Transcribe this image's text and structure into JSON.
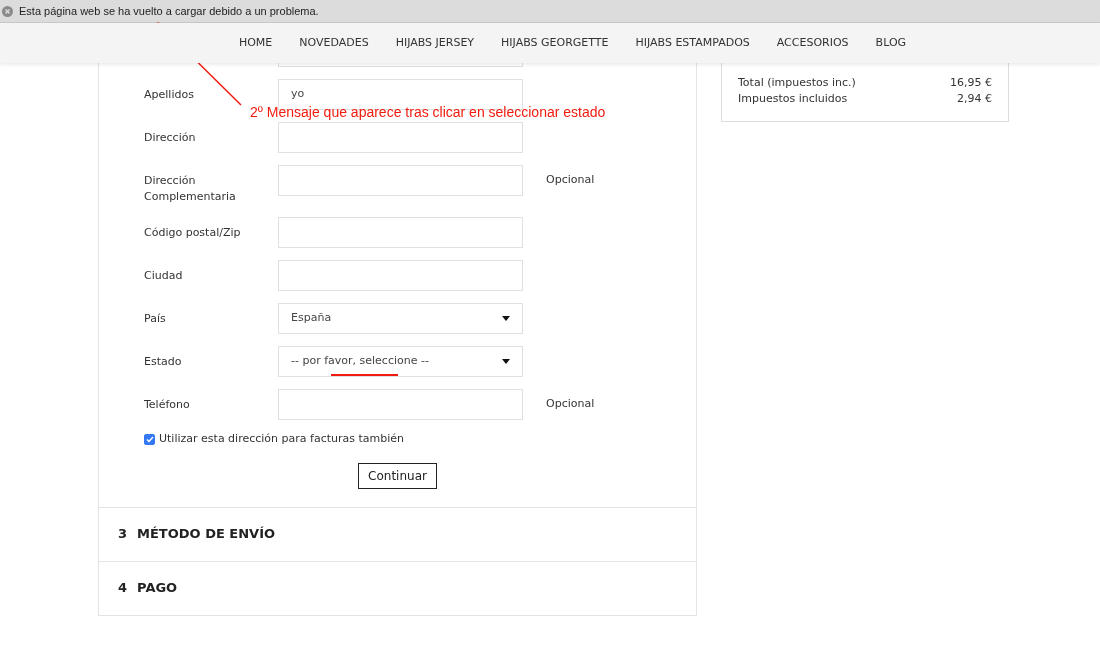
{
  "notice": {
    "text": "Esta página web se ha vuelto a cargar debido a un problema."
  },
  "nav": {
    "items": [
      "HOME",
      "NOVEDADES",
      "HIJABS JERSEY",
      "HIJABS GEORGETTE",
      "HIJABS ESTAMPADOS",
      "ACCESORIOS",
      "BLOG"
    ]
  },
  "address_form": {
    "fields": [
      {
        "kind": "stub"
      },
      {
        "kind": "input",
        "label": "Apellidos",
        "value": "yo"
      },
      {
        "kind": "input",
        "label": "Dirección"
      },
      {
        "kind": "input",
        "label": "Dirección Complementaria",
        "note": "Opcional"
      },
      {
        "kind": "input",
        "label": "Código postal/Zip"
      },
      {
        "kind": "input",
        "label": "Ciudad"
      },
      {
        "kind": "select",
        "label": "País",
        "value": "España"
      },
      {
        "kind": "select",
        "label": "Estado",
        "value": "-- por favor, seleccione --"
      },
      {
        "kind": "input",
        "label": "Teléfono",
        "note": "Opcional"
      }
    ],
    "billing_checkbox": {
      "label": "Utilizar esta dirección para facturas también",
      "checked": true
    },
    "button": "Continuar"
  },
  "steps": [
    {
      "number": "3",
      "title": "MÉTODO DE ENVÍO"
    },
    {
      "number": "4",
      "title": "PAGO"
    }
  ],
  "summary": {
    "rows": [
      {
        "label": "Total (impuestos inc.)",
        "value": "16,95 €"
      },
      {
        "label": "Impuestos incluidos",
        "value": "2,94 €"
      }
    ]
  },
  "annotation": {
    "text": "2º Mensaje que aparece tras clicar en seleccionar estado"
  }
}
